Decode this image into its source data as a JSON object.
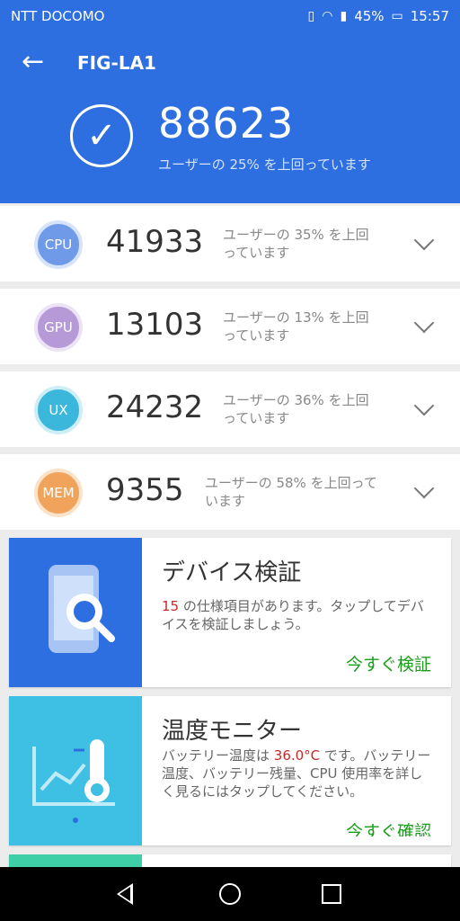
{
  "status_bar": {
    "carrier": "NTT DOCOMO",
    "battery": "45%",
    "time": "15:57"
  },
  "header": {
    "device": "FIG-LA1",
    "total_score": "88623",
    "total_desc": "ユーザーの 25% を上回っています"
  },
  "scores": [
    {
      "label": "CPU",
      "score": "41933",
      "desc": "ユーザーの 35% を上回っています",
      "color": "#6f9ae8"
    },
    {
      "label": "GPU",
      "score": "13103",
      "desc": "ユーザーの 13% を上回っています",
      "color": "#b69ad8"
    },
    {
      "label": "UX",
      "score": "24232",
      "desc": "ユーザーの 36% を上回っています",
      "color": "#3bb7dc"
    },
    {
      "label": "MEM",
      "score": "9355",
      "desc": "ユーザーの 58% を上回っています",
      "color": "#f0a35a"
    }
  ],
  "cards": [
    {
      "title": "デバイス検証",
      "count": "15",
      "text": " の仕様項目があります。タップしてデバイスを検証しましょう。",
      "action": "今すぐ検証",
      "color": "#2d6ee0"
    },
    {
      "title": "温度モニター",
      "text_before": "バッテリー温度は ",
      "temperature": "36.0°C",
      "text_after": " です。バッテリー温度、バッテリー残量、CPU 使用率を詳しく見るにはタップしてください。",
      "action": "今すぐ確認",
      "color": "#3ec0e4"
    }
  ],
  "third_card_color": "#3fcfa6"
}
